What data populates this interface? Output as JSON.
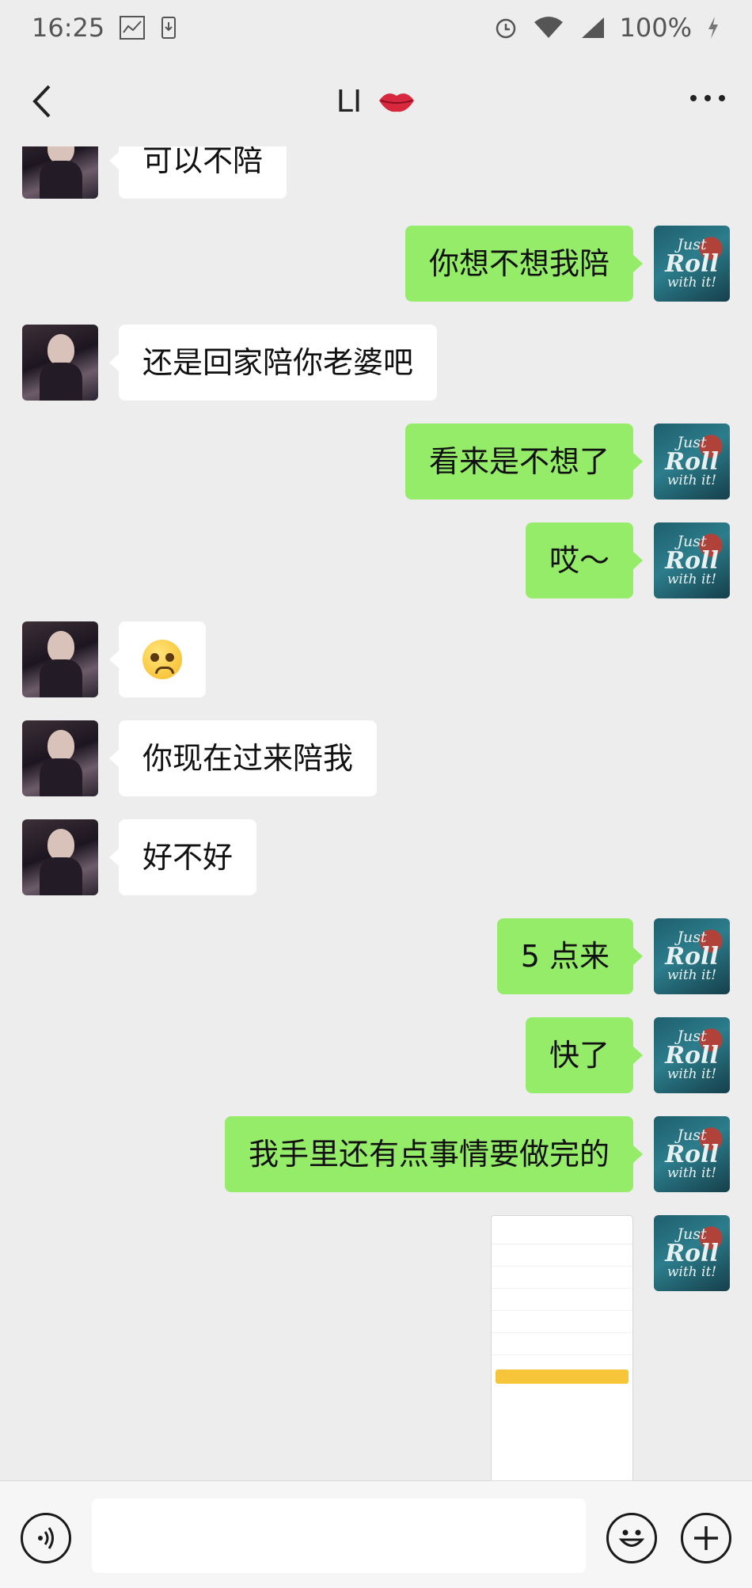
{
  "status_bar": {
    "time": "16:25",
    "battery": "100%"
  },
  "header": {
    "title": "LI",
    "title_icon": "lips-icon"
  },
  "messages": [
    {
      "side": "left",
      "text": "可以不陪"
    },
    {
      "side": "right",
      "text": "你想不想我陪"
    },
    {
      "side": "left",
      "text": "还是回家陪你老婆吧"
    },
    {
      "side": "right",
      "text": "看来是不想了"
    },
    {
      "side": "right",
      "text": "哎～"
    },
    {
      "side": "left",
      "type": "emoji",
      "emoji": "pleading-face"
    },
    {
      "side": "left",
      "text": "你现在过来陪我"
    },
    {
      "side": "left",
      "text": "好不好"
    },
    {
      "side": "right",
      "text": "5 点来"
    },
    {
      "side": "right",
      "text": "快了"
    },
    {
      "side": "right",
      "text": "我手里还有点事情要做完的"
    },
    {
      "side": "right",
      "type": "image",
      "description": "screenshot-thumbnail"
    }
  ],
  "my_avatar": {
    "line1": "Just",
    "line2": "Roll",
    "line3": "with it!"
  },
  "colors": {
    "background": "#ededed",
    "my_bubble": "#95ec69",
    "their_bubble": "#ffffff"
  },
  "input_bar": {
    "value": ""
  }
}
